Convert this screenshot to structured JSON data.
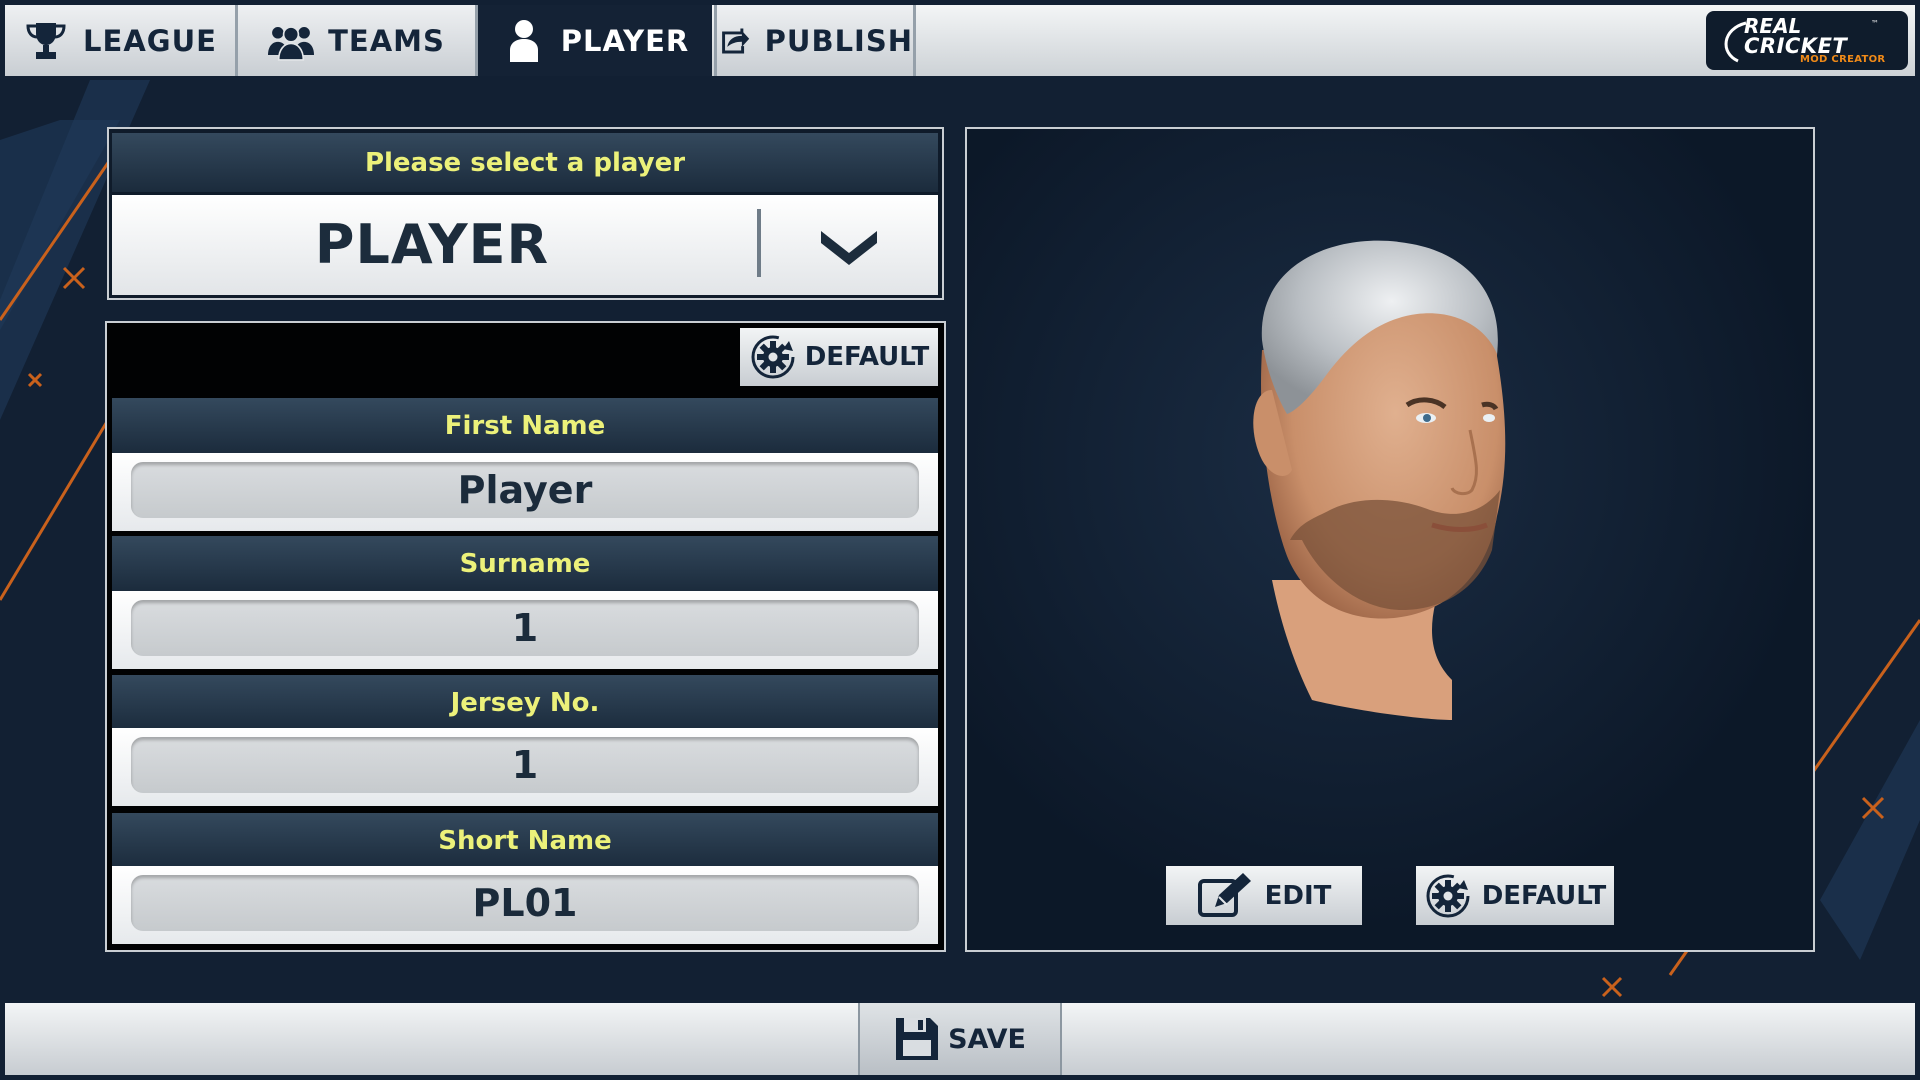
{
  "nav": {
    "tabs": [
      {
        "label": "LEAGUE",
        "icon": "trophy-icon",
        "active": false
      },
      {
        "label": "TEAMS",
        "icon": "team-icon",
        "active": false
      },
      {
        "label": "PLAYER",
        "icon": "player-icon",
        "active": true
      },
      {
        "label": "PUBLISH",
        "icon": "publish-icon",
        "active": false
      }
    ],
    "logo": {
      "line1": "REAL",
      "line2": "CRICKET",
      "subtitle": "MOD CREATOR",
      "mark": "™"
    }
  },
  "player_select": {
    "header": "Please select a player",
    "value": "PLAYER",
    "toggle_icon": "chevron-down-icon"
  },
  "form": {
    "default_label": "DEFAULT",
    "fields": [
      {
        "label": "First Name",
        "value": "Player"
      },
      {
        "label": "Surname",
        "value": "1"
      },
      {
        "label": "Jersey No.",
        "value": "1"
      },
      {
        "label": "Short Name",
        "value": "PL01"
      }
    ]
  },
  "preview": {
    "edit_label": "EDIT",
    "default_label": "DEFAULT"
  },
  "footer": {
    "save_label": "SAVE",
    "icon": "save-icon"
  },
  "colors": {
    "background": "#122033",
    "label_yellow": "#ecf17a",
    "accent_orange": "#c9611c",
    "text_dark": "#14253a"
  }
}
